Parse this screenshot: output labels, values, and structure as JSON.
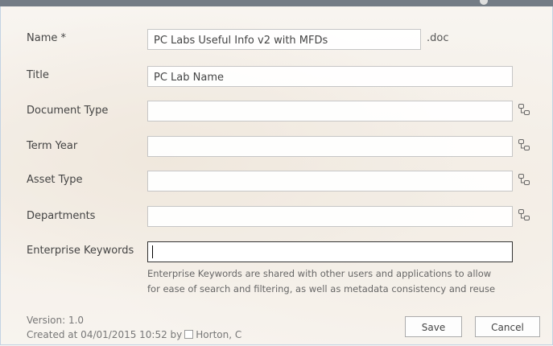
{
  "form": {
    "name_label": "Name *",
    "name_value": "PC Labs Useful Info v2 with MFDs",
    "name_ext": ".doc",
    "title_label": "Title",
    "title_value": "PC Lab Name",
    "document_type_label": "Document Type",
    "term_year_label": "Term Year",
    "asset_type_label": "Asset Type",
    "departments_label": "Departments",
    "enterprise_keywords_label": "Enterprise Keywords",
    "enterprise_keywords_help_1": "Enterprise Keywords are shared with other users and applications to allow",
    "enterprise_keywords_help_2": "for ease of search and filtering, as well as metadata consistency and reuse"
  },
  "footer": {
    "version": "Version: 1.0",
    "created_prefix": "Created at 04/01/2015 10:52  by",
    "created_user": "Horton, C",
    "save_label": "Save",
    "cancel_label": "Cancel"
  },
  "icons": {
    "tag": "browse-terms-icon"
  }
}
